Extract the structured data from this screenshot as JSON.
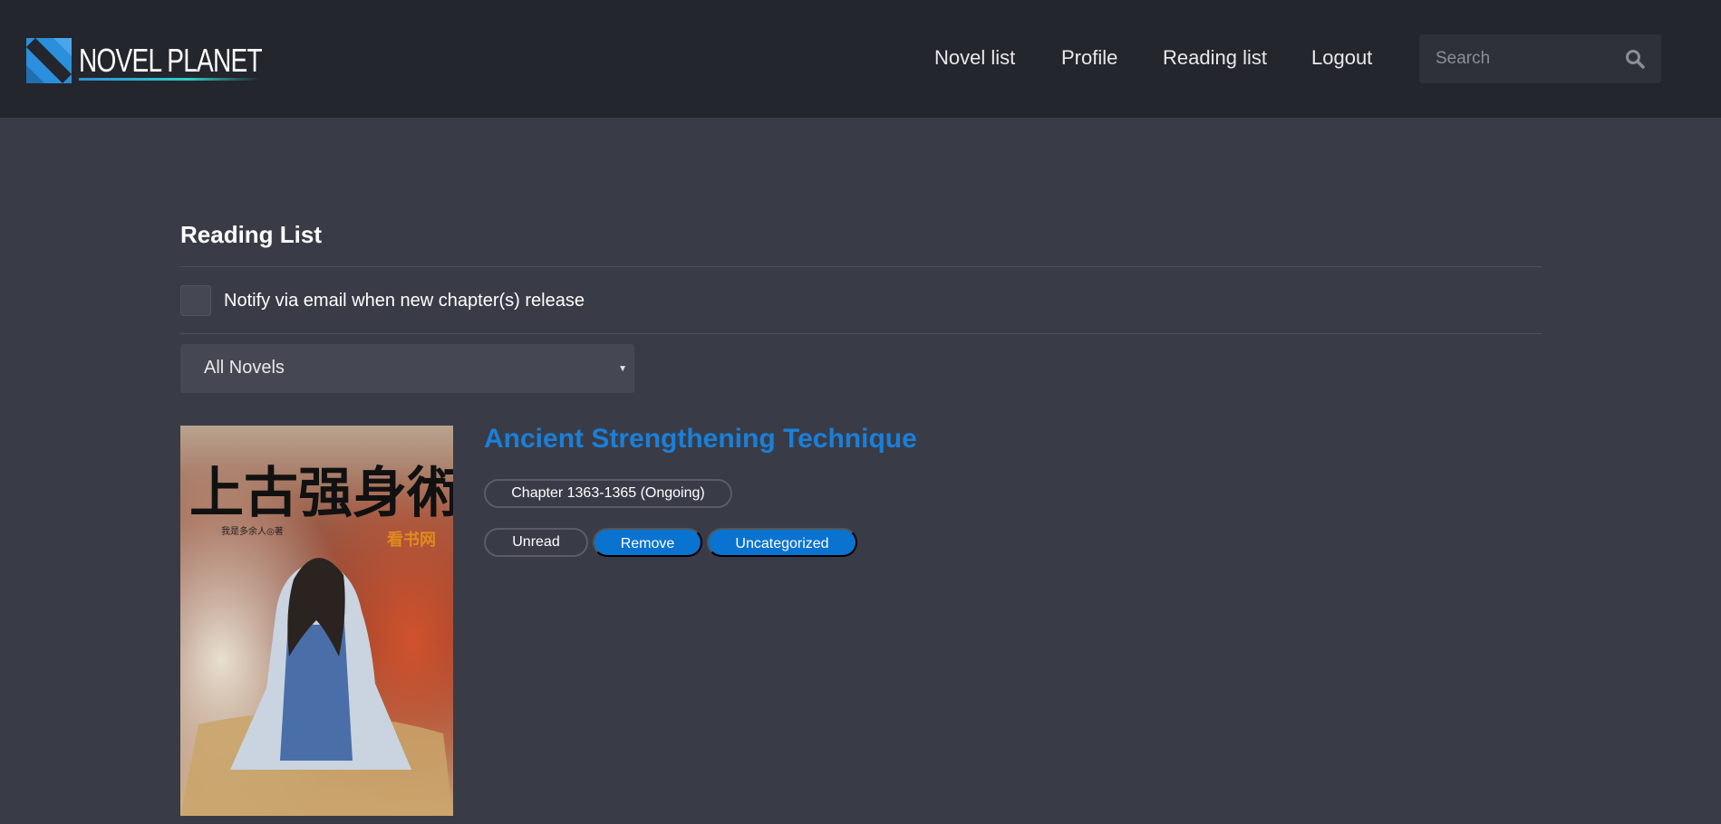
{
  "header": {
    "logo_text": "NOVEL PLANET",
    "nav": [
      "Novel list",
      "Profile",
      "Reading list",
      "Logout"
    ],
    "search_placeholder": "Search",
    "search_icon": "search-icon"
  },
  "page": {
    "title": "Reading List",
    "notify_label": "Notify via email when new chapter(s) release",
    "notify_checked": false,
    "filter_selected": "All Novels"
  },
  "novels": [
    {
      "title": "Ancient Strengthening Technique",
      "chapter": "Chapter 1363-1365 (Ongoing)",
      "status_label": "Unread",
      "remove_label": "Remove",
      "category_label": "Uncategorized",
      "cover_text": "上古强身術",
      "cover_author": "我是多余人◎著",
      "cover_stamp": "看书网"
    }
  ],
  "colors": {
    "header_bg": "#24262d",
    "page_bg": "#393c47",
    "accent": "#1a7fd8",
    "button_blue": "#0a73d0"
  }
}
